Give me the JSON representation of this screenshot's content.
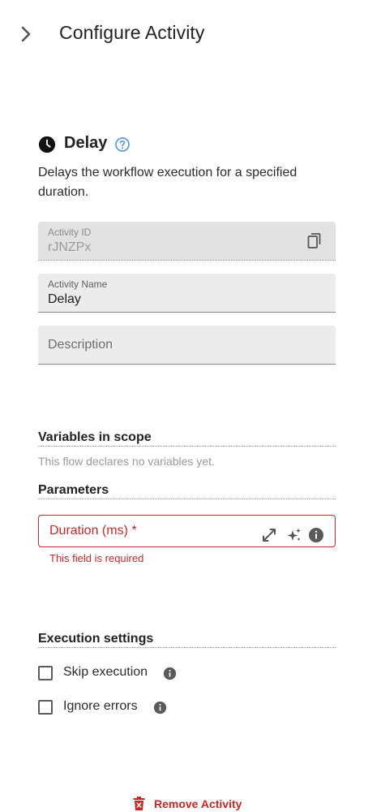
{
  "header": {
    "title": "Configure Activity",
    "collapse_icon": "chevron-right-icon"
  },
  "activity": {
    "icon": "clock-icon",
    "name": "Delay",
    "help_icon": "help-circle-icon",
    "description": "Delays the workflow execution for a specified duration."
  },
  "fields": {
    "activity_id": {
      "label": "Activity ID",
      "value": "rJNZPx",
      "copy_icon": "copy-icon"
    },
    "activity_name": {
      "label": "Activity Name",
      "value": "Delay"
    },
    "description": {
      "placeholder": "Description"
    }
  },
  "variables": {
    "heading": "Variables in scope",
    "empty_text": "This flow declares no variables yet."
  },
  "parameters": {
    "heading": "Parameters",
    "duration": {
      "label": "Duration (ms) *",
      "error": "This field is required",
      "icons": [
        "expand-icon",
        "sparkles-icon",
        "info-icon"
      ]
    }
  },
  "execution": {
    "heading": "Execution settings",
    "options": [
      {
        "label": "Skip execution",
        "checked": false
      },
      {
        "label": "Ignore errors",
        "checked": false
      }
    ]
  },
  "footer": {
    "remove_label": "Remove Activity",
    "remove_icon": "trash-icon"
  },
  "colors": {
    "error": "#c62828",
    "help": "#5b9bd5",
    "field_bg": "#ececec"
  }
}
